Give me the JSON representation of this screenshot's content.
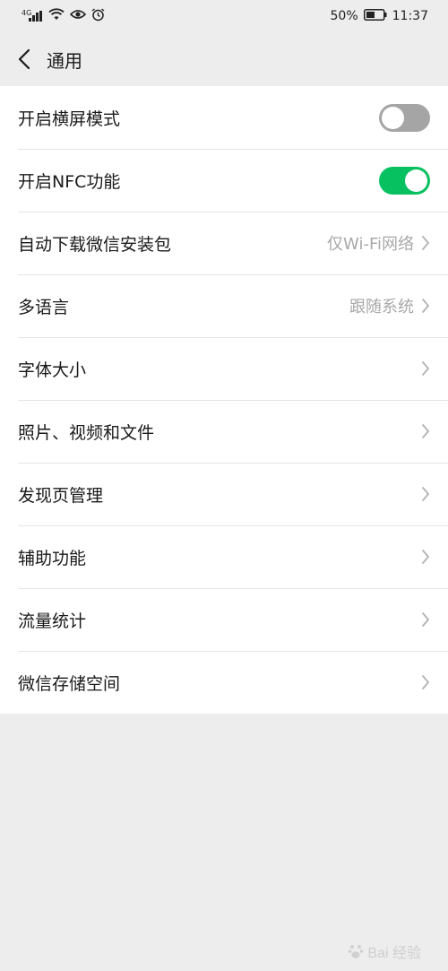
{
  "status_bar": {
    "network": "4G",
    "battery_percent": "50%",
    "time": "11:37"
  },
  "header": {
    "title": "通用"
  },
  "settings": [
    {
      "label": "开启横屏模式",
      "type": "toggle",
      "enabled": false
    },
    {
      "label": "开启NFC功能",
      "type": "toggle",
      "enabled": true
    },
    {
      "label": "自动下载微信安装包",
      "type": "link",
      "value": "仅Wi-Fi网络"
    },
    {
      "label": "多语言",
      "type": "link",
      "value": "跟随系统"
    },
    {
      "label": "字体大小",
      "type": "link"
    },
    {
      "label": "照片、视频和文件",
      "type": "link"
    },
    {
      "label": "发现页管理",
      "type": "link"
    },
    {
      "label": "辅助功能",
      "type": "link"
    },
    {
      "label": "流量统计",
      "type": "link"
    },
    {
      "label": "微信存储空间",
      "type": "link"
    }
  ],
  "colors": {
    "toggle_on": "#07c160",
    "toggle_off": "#a5a5a5",
    "background": "#ededed"
  },
  "watermark": "Bai 经验"
}
